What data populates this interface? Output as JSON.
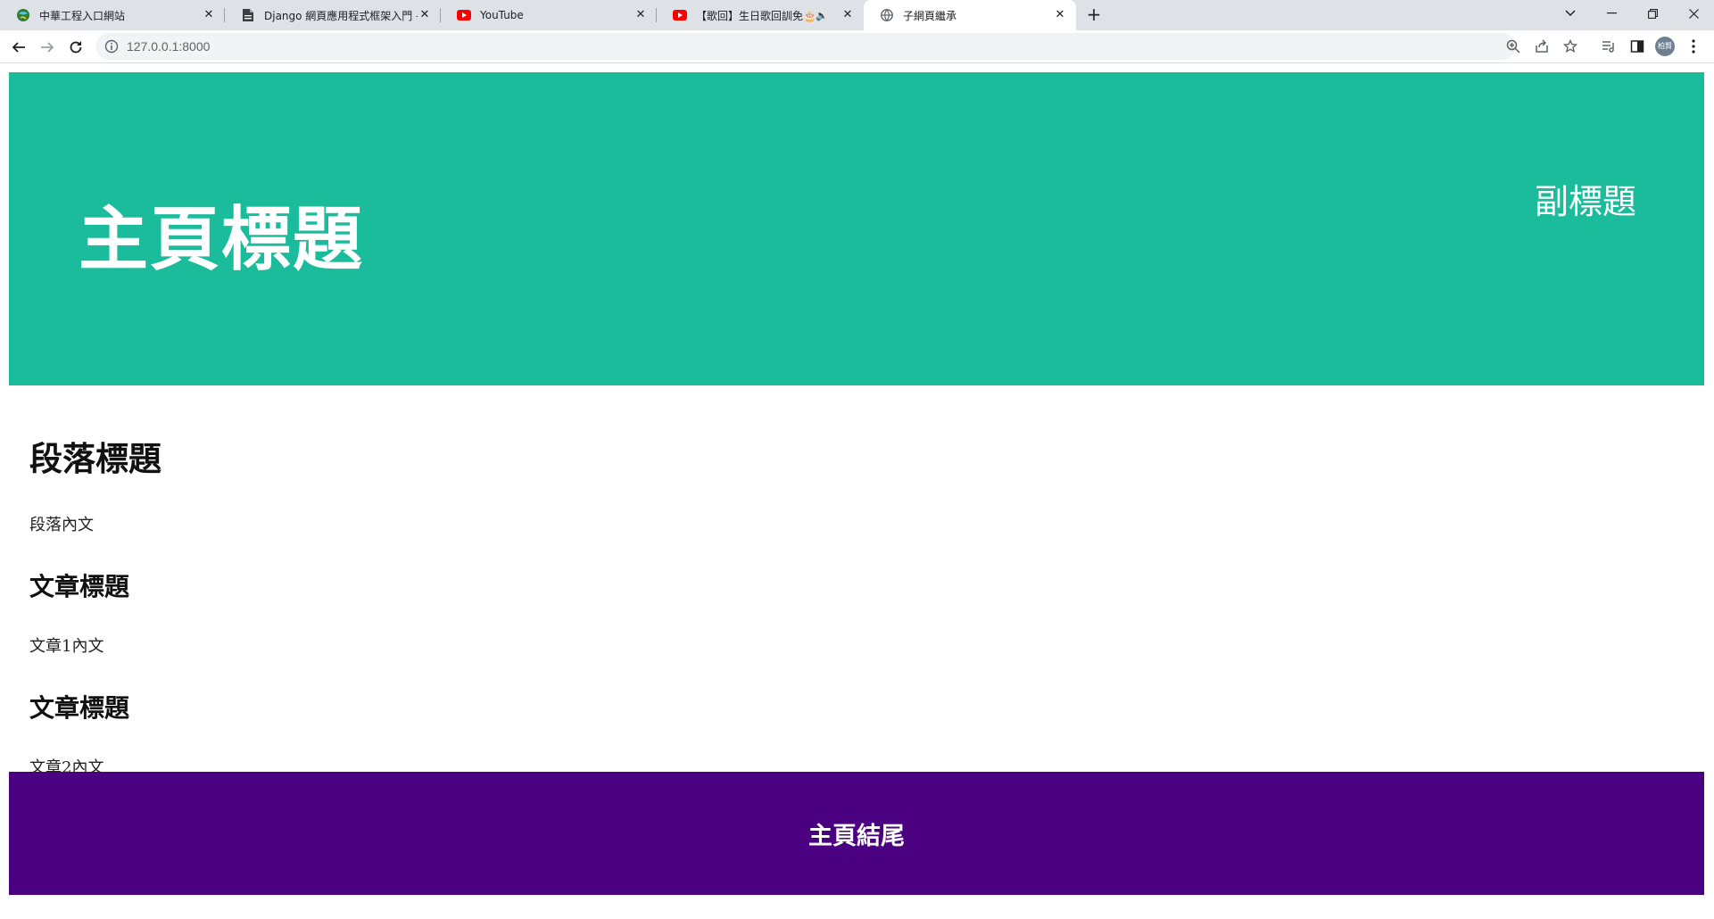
{
  "browser": {
    "tabs": [
      {
        "title": "中華工程入口網站",
        "icon": "globe-icon"
      },
      {
        "title": "Django 網頁應用程式框架入門 -",
        "icon": "document-icon"
      },
      {
        "title": "YouTube",
        "icon": "youtube-icon"
      },
      {
        "title": "【歌回】生日歌回訓免🎂 |",
        "icon": "youtube-icon",
        "audio": "speaker-icon"
      },
      {
        "title": "子網頁繼承",
        "icon": "globe-icon",
        "active": true
      }
    ],
    "address": {
      "url": "127.0.0.1:8000"
    },
    "profile_initials": "柏賢"
  },
  "page": {
    "header": {
      "title": "主頁標題",
      "subtitle": "副標題",
      "background": "#1abc9c"
    },
    "section": {
      "heading": "段落標題",
      "text": "段落內文",
      "articles": [
        {
          "heading": "文章標題",
          "text": "文章1內文"
        },
        {
          "heading": "文章標題",
          "text": "文章2內文"
        }
      ]
    },
    "footer": {
      "text": "主頁結尾",
      "background": "#4b0082"
    }
  }
}
